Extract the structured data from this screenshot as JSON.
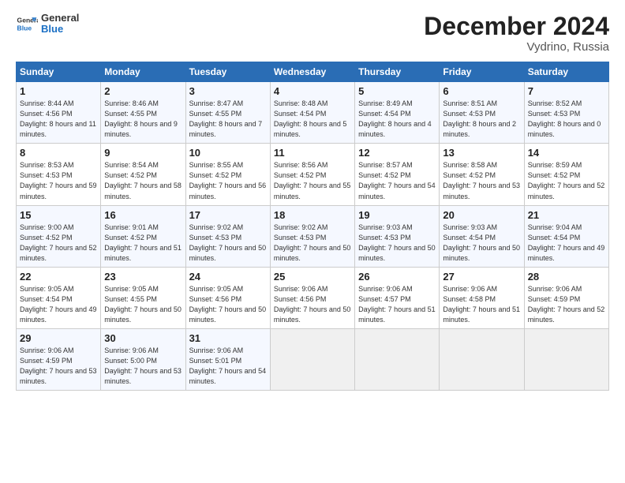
{
  "logo": {
    "general": "General",
    "blue": "Blue"
  },
  "title": "December 2024",
  "location": "Vydrino, Russia",
  "days_of_week": [
    "Sunday",
    "Monday",
    "Tuesday",
    "Wednesday",
    "Thursday",
    "Friday",
    "Saturday"
  ],
  "weeks": [
    [
      {
        "day": 1,
        "sunrise": "8:44 AM",
        "sunset": "4:56 PM",
        "daylight": "8 hours and 11 minutes."
      },
      {
        "day": 2,
        "sunrise": "8:46 AM",
        "sunset": "4:55 PM",
        "daylight": "8 hours and 9 minutes."
      },
      {
        "day": 3,
        "sunrise": "8:47 AM",
        "sunset": "4:55 PM",
        "daylight": "8 hours and 7 minutes."
      },
      {
        "day": 4,
        "sunrise": "8:48 AM",
        "sunset": "4:54 PM",
        "daylight": "8 hours and 5 minutes."
      },
      {
        "day": 5,
        "sunrise": "8:49 AM",
        "sunset": "4:54 PM",
        "daylight": "8 hours and 4 minutes."
      },
      {
        "day": 6,
        "sunrise": "8:51 AM",
        "sunset": "4:53 PM",
        "daylight": "8 hours and 2 minutes."
      },
      {
        "day": 7,
        "sunrise": "8:52 AM",
        "sunset": "4:53 PM",
        "daylight": "8 hours and 0 minutes."
      }
    ],
    [
      {
        "day": 8,
        "sunrise": "8:53 AM",
        "sunset": "4:53 PM",
        "daylight": "7 hours and 59 minutes."
      },
      {
        "day": 9,
        "sunrise": "8:54 AM",
        "sunset": "4:52 PM",
        "daylight": "7 hours and 58 minutes."
      },
      {
        "day": 10,
        "sunrise": "8:55 AM",
        "sunset": "4:52 PM",
        "daylight": "7 hours and 56 minutes."
      },
      {
        "day": 11,
        "sunrise": "8:56 AM",
        "sunset": "4:52 PM",
        "daylight": "7 hours and 55 minutes."
      },
      {
        "day": 12,
        "sunrise": "8:57 AM",
        "sunset": "4:52 PM",
        "daylight": "7 hours and 54 minutes."
      },
      {
        "day": 13,
        "sunrise": "8:58 AM",
        "sunset": "4:52 PM",
        "daylight": "7 hours and 53 minutes."
      },
      {
        "day": 14,
        "sunrise": "8:59 AM",
        "sunset": "4:52 PM",
        "daylight": "7 hours and 52 minutes."
      }
    ],
    [
      {
        "day": 15,
        "sunrise": "9:00 AM",
        "sunset": "4:52 PM",
        "daylight": "7 hours and 52 minutes."
      },
      {
        "day": 16,
        "sunrise": "9:01 AM",
        "sunset": "4:52 PM",
        "daylight": "7 hours and 51 minutes."
      },
      {
        "day": 17,
        "sunrise": "9:02 AM",
        "sunset": "4:53 PM",
        "daylight": "7 hours and 50 minutes."
      },
      {
        "day": 18,
        "sunrise": "9:02 AM",
        "sunset": "4:53 PM",
        "daylight": "7 hours and 50 minutes."
      },
      {
        "day": 19,
        "sunrise": "9:03 AM",
        "sunset": "4:53 PM",
        "daylight": "7 hours and 50 minutes."
      },
      {
        "day": 20,
        "sunrise": "9:03 AM",
        "sunset": "4:54 PM",
        "daylight": "7 hours and 50 minutes."
      },
      {
        "day": 21,
        "sunrise": "9:04 AM",
        "sunset": "4:54 PM",
        "daylight": "7 hours and 49 minutes."
      }
    ],
    [
      {
        "day": 22,
        "sunrise": "9:05 AM",
        "sunset": "4:54 PM",
        "daylight": "7 hours and 49 minutes."
      },
      {
        "day": 23,
        "sunrise": "9:05 AM",
        "sunset": "4:55 PM",
        "daylight": "7 hours and 50 minutes."
      },
      {
        "day": 24,
        "sunrise": "9:05 AM",
        "sunset": "4:56 PM",
        "daylight": "7 hours and 50 minutes."
      },
      {
        "day": 25,
        "sunrise": "9:06 AM",
        "sunset": "4:56 PM",
        "daylight": "7 hours and 50 minutes."
      },
      {
        "day": 26,
        "sunrise": "9:06 AM",
        "sunset": "4:57 PM",
        "daylight": "7 hours and 51 minutes."
      },
      {
        "day": 27,
        "sunrise": "9:06 AM",
        "sunset": "4:58 PM",
        "daylight": "7 hours and 51 minutes."
      },
      {
        "day": 28,
        "sunrise": "9:06 AM",
        "sunset": "4:59 PM",
        "daylight": "7 hours and 52 minutes."
      }
    ],
    [
      {
        "day": 29,
        "sunrise": "9:06 AM",
        "sunset": "4:59 PM",
        "daylight": "7 hours and 53 minutes."
      },
      {
        "day": 30,
        "sunrise": "9:06 AM",
        "sunset": "5:00 PM",
        "daylight": "7 hours and 53 minutes."
      },
      {
        "day": 31,
        "sunrise": "9:06 AM",
        "sunset": "5:01 PM",
        "daylight": "7 hours and 54 minutes."
      },
      null,
      null,
      null,
      null
    ]
  ]
}
